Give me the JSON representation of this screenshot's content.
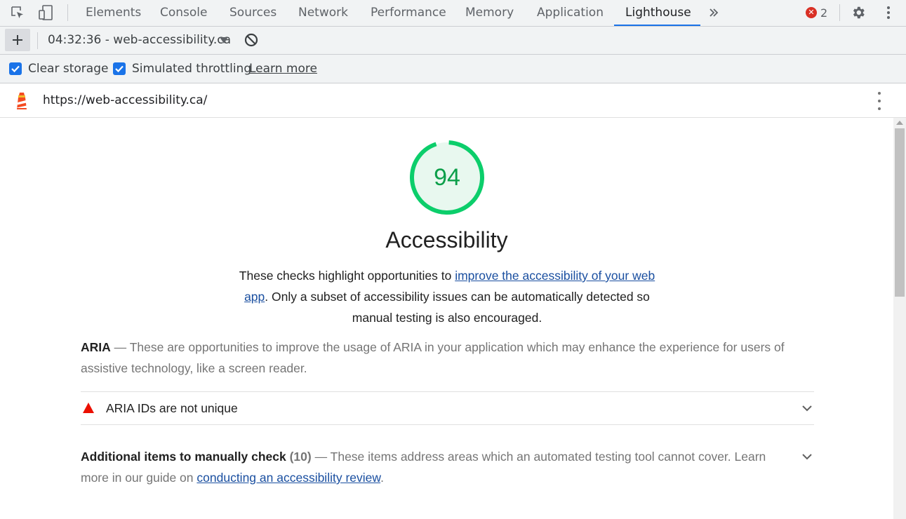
{
  "devtools": {
    "tabs": [
      "Elements",
      "Console",
      "Sources",
      "Network",
      "Performance",
      "Memory",
      "Application",
      "Lighthouse"
    ],
    "active_tab": "Lighthouse",
    "error_count": "2",
    "icons": [
      "inspect-element-icon",
      "device-toolbar-icon",
      "more-tabs-icon",
      "error-icon",
      "settings-gear-icon",
      "more-options-icon"
    ]
  },
  "lighthouse_toolbar": {
    "report_selector": "04:32:36 - web-accessibility.ca",
    "options": {
      "clear_storage": {
        "label": "Clear storage",
        "checked": true
      },
      "simulated_throttling": {
        "label": "Simulated throttling",
        "checked": true
      },
      "learn_more": "Learn more"
    }
  },
  "url_bar": {
    "url": "https://web-accessibility.ca/"
  },
  "report": {
    "score": "94",
    "score_color": "#0cce6b",
    "category_title": "Accessibility",
    "description": {
      "before": "These checks highlight opportunities to ",
      "link": "improve the accessibility of your web app",
      "after": ". Only a subset of accessibility issues can be automatically detected so manual testing is also encouraged."
    },
    "group": {
      "title": "ARIA",
      "separator": " — ",
      "description": "These are opportunities to improve the usage of ARIA in your application which may enhance the experience for users of assistive technology, like a screen reader."
    },
    "audits": [
      {
        "title": "ARIA IDs are not unique",
        "status": "fail"
      }
    ],
    "manual": {
      "title": "Additional items to manually check",
      "count": "(10)",
      "separator": " — ",
      "description": "These items address areas which an automated testing tool cannot cover. Learn more in our guide on ",
      "link": "conducting an accessibility review",
      "end": "."
    }
  }
}
